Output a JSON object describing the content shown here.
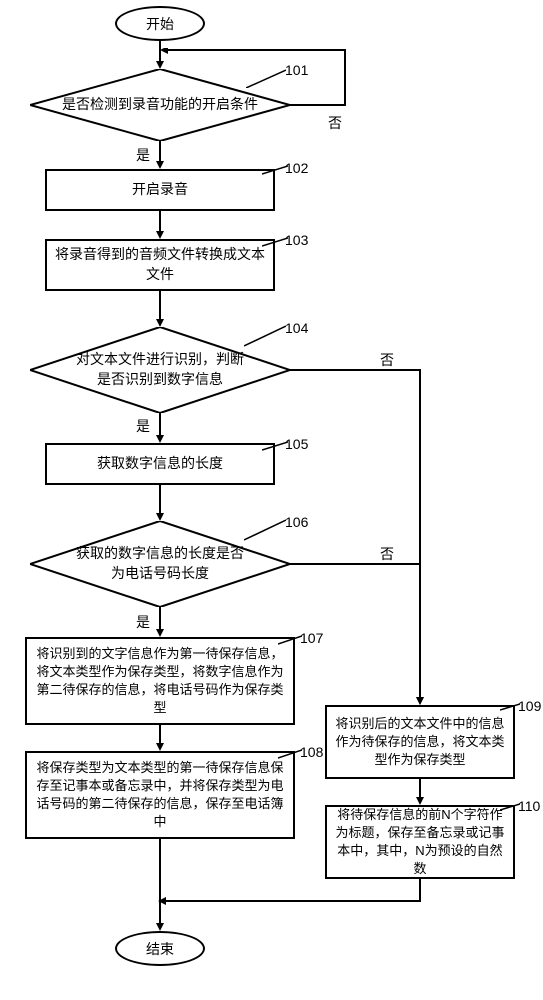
{
  "chart_data": {
    "type": "flowchart",
    "nodes": [
      {
        "id": "start",
        "type": "terminal",
        "text": "开始"
      },
      {
        "id": "d101",
        "type": "decision",
        "text": "是否检测到录音功能的开启条件",
        "number": "101"
      },
      {
        "id": "p102",
        "type": "process",
        "text": "开启录音",
        "number": "102"
      },
      {
        "id": "p103",
        "type": "process",
        "text": "将录音得到的音频文件转换成文本文件",
        "number": "103"
      },
      {
        "id": "d104",
        "type": "decision",
        "text": "对文本文件进行识别，判断是否识别到数字信息",
        "number": "104"
      },
      {
        "id": "p105",
        "type": "process",
        "text": "获取数字信息的长度",
        "number": "105"
      },
      {
        "id": "d106",
        "type": "decision",
        "text": "获取的数字信息的长度是否为电话号码长度",
        "number": "106"
      },
      {
        "id": "p107",
        "type": "process",
        "text": "将识别到的文字信息作为第一待保存信息，将文本类型作为保存类型，将数字信息作为第二待保存的信息，将电话号码作为保存类型",
        "number": "107"
      },
      {
        "id": "p108",
        "type": "process",
        "text": "将保存类型为文本类型的第一待保存信息保存至记事本或备忘录中，并将保存类型为电话号码的第二待保存的信息，保存至电话簿中",
        "number": "108"
      },
      {
        "id": "p109",
        "type": "process",
        "text": "将识别后的文本文件中的信息作为待保存的信息，将文本类型作为保存类型",
        "number": "109"
      },
      {
        "id": "p110",
        "type": "process",
        "text": "将待保存信息的前N个字符作为标题，保存至备忘录或记事本中，其中，N为预设的自然数",
        "number": "110"
      },
      {
        "id": "end",
        "type": "terminal",
        "text": "结束"
      }
    ],
    "edges": [
      {
        "from": "start",
        "to": "d101"
      },
      {
        "from": "d101",
        "to": "p102",
        "label": "是"
      },
      {
        "from": "d101",
        "to": "d101",
        "label": "否",
        "loop": true
      },
      {
        "from": "p102",
        "to": "p103"
      },
      {
        "from": "p103",
        "to": "d104"
      },
      {
        "from": "d104",
        "to": "p105",
        "label": "是"
      },
      {
        "from": "d104",
        "to": "p109",
        "label": "否"
      },
      {
        "from": "p105",
        "to": "d106"
      },
      {
        "from": "d106",
        "to": "p107",
        "label": "是"
      },
      {
        "from": "d106",
        "to": "p109",
        "label": "否"
      },
      {
        "from": "p107",
        "to": "p108"
      },
      {
        "from": "p108",
        "to": "end"
      },
      {
        "from": "p109",
        "to": "p110"
      },
      {
        "from": "p110",
        "to": "end"
      }
    ]
  },
  "labels": {
    "yes": "是",
    "no": "否"
  }
}
